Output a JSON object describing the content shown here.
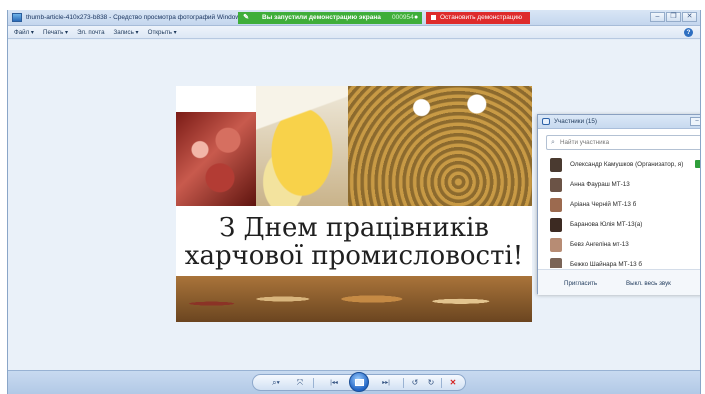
{
  "window": {
    "title": "thumb-article-410x273-b838 - Средство просмотра фотографий Windows",
    "controls": [
      "–",
      "❐",
      "✕"
    ]
  },
  "screen_share": {
    "status_text": "Вы запустили демонстрацию экрана",
    "timer": "000954",
    "stop_label": "Остановить демонстрацию",
    "status_color": "#3fae3a",
    "stop_color": "#de2b2b"
  },
  "menu": {
    "items": [
      "Файл ▾",
      "Печать ▾",
      "Эл. почта",
      "Запись ▾",
      "Открыть ▾"
    ],
    "help": "?"
  },
  "photo": {
    "caption_line1": "З Днем працівників",
    "caption_line2": "харчової промисловості!"
  },
  "participants": {
    "title": "Участники (15)",
    "search_placeholder": "Найти участника",
    "list": [
      {
        "name": "Олександр Камушков (Организатор, я)",
        "avatar_color": "#4a3a30",
        "host": true
      },
      {
        "name": "Анна Фаурaш МТ-13",
        "avatar_color": "#6b5346"
      },
      {
        "name": "Аріана Черній МТ-13 б",
        "avatar_color": "#9c6a4f"
      },
      {
        "name": "Баранова Юлія МТ-13(а)",
        "avatar_color": "#3c2a22"
      },
      {
        "name": "Бевз Ангеліна мт-13",
        "avatar_color": "#b78c74"
      },
      {
        "name": "Бежко Шайнара МТ-13 б",
        "avatar_color": "#7a6457"
      }
    ],
    "invite_label": "Пригласить",
    "mute_all_label": "Выкл. весь звук"
  },
  "toolbar": {
    "zoom": "⌕▾",
    "fit": "⤧",
    "prev": "|◂◂",
    "next": "▸▸|",
    "rotate_left": "↺",
    "rotate_right": "↻",
    "delete": "✕"
  }
}
